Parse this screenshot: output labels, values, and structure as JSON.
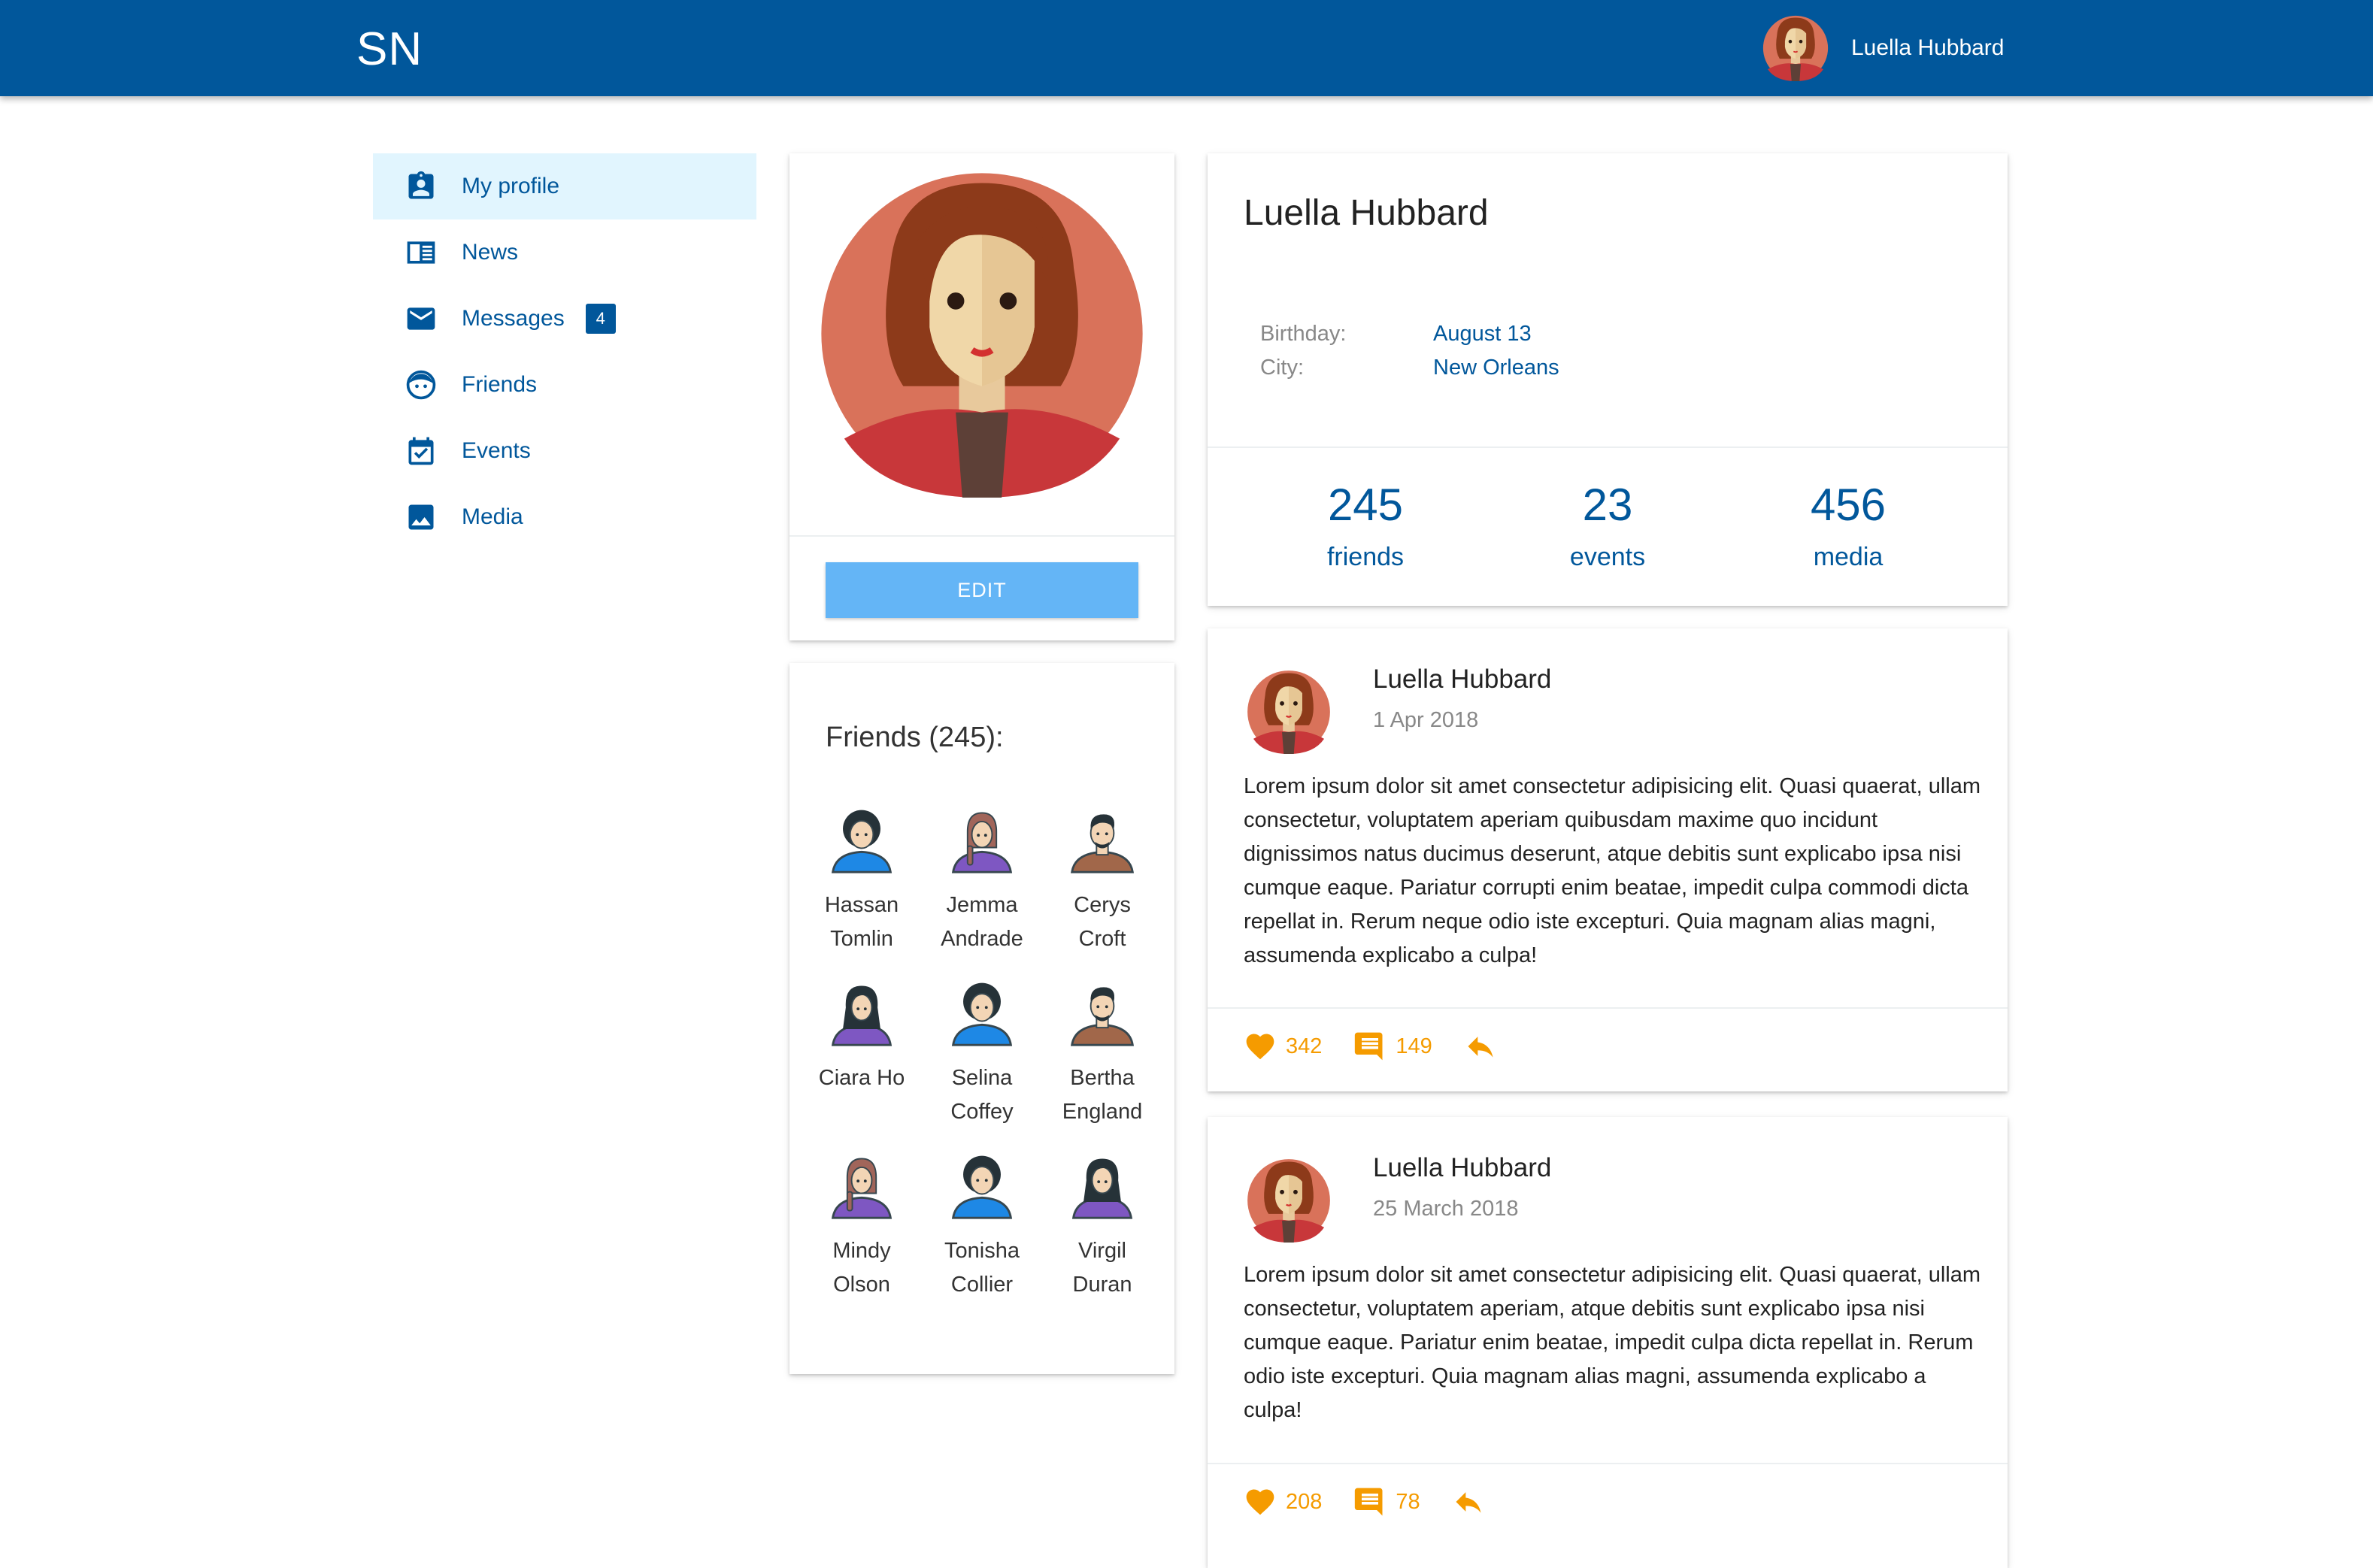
{
  "app": {
    "logo": "SN"
  },
  "header": {
    "user_name": "Luella Hubbard"
  },
  "sidebar": {
    "items": [
      {
        "label": "My profile",
        "icon": "profile-badge-icon",
        "active": true
      },
      {
        "label": "News",
        "icon": "newspaper-icon"
      },
      {
        "label": "Messages",
        "icon": "envelope-icon",
        "badge": "4"
      },
      {
        "label": "Friends",
        "icon": "face-icon"
      },
      {
        "label": "Events",
        "icon": "calendar-check-icon"
      },
      {
        "label": "Media",
        "icon": "image-icon"
      }
    ]
  },
  "profile": {
    "edit_label": "EDIT",
    "name": "Luella Hubbard",
    "birthday_label": "Birthday:",
    "birthday_value": "August 13",
    "city_label": "City:",
    "city_value": "New Orleans",
    "stats": [
      {
        "value": "245",
        "label": "friends"
      },
      {
        "value": "23",
        "label": "events"
      },
      {
        "value": "456",
        "label": "media"
      }
    ]
  },
  "friends": {
    "title": "Friends (245):",
    "list": [
      {
        "first": "Hassan",
        "last": "Tomlin",
        "avatar": "afro-blue"
      },
      {
        "first": "Jemma",
        "last": "Andrade",
        "avatar": "braid-purple"
      },
      {
        "first": "Cerys",
        "last": "Croft",
        "avatar": "man-brown"
      },
      {
        "first": "Ciara Ho",
        "last": "",
        "avatar": "longhair-purple"
      },
      {
        "first": "Selina",
        "last": "Coffey",
        "avatar": "afro-blue"
      },
      {
        "first": "Bertha",
        "last": "England",
        "avatar": "man-brown"
      },
      {
        "first": "Mindy",
        "last": "Olson",
        "avatar": "braid-purple"
      },
      {
        "first": "Tonisha",
        "last": "Collier",
        "avatar": "afro-blue"
      },
      {
        "first": "Virgil",
        "last": "Duran",
        "avatar": "longhair-purple"
      }
    ]
  },
  "posts": [
    {
      "author": "Luella Hubbard",
      "date": "1 Apr 2018",
      "text": "Lorem ipsum dolor sit amet consectetur adipisicing elit. Quasi quaerat, ullam consectetur, voluptatem aperiam quibusdam maxime quo incidunt dignissimos natus ducimus deserunt, atque debitis sunt explicabo ipsa nisi cumque eaque. Pariatur corrupti enim beatae, impedit culpa commodi dicta repellat in. Rerum neque odio iste excepturi. Quia magnam alias magni, assumenda explicabo a culpa!",
      "likes": "342",
      "comments": "149"
    },
    {
      "author": "Luella Hubbard",
      "date": "25 March 2018",
      "text": "Lorem ipsum dolor sit amet consectetur adipisicing elit. Quasi quaerat, ullam consectetur, voluptatem aperiam, atque debitis sunt explicabo ipsa nisi cumque eaque. Pariatur enim beatae, impedit culpa dicta repellat in. Rerum odio iste excepturi. Quia magnam alias magni, assumenda explicabo a culpa!",
      "likes": "208",
      "comments": "78"
    }
  ],
  "colors": {
    "primary": "#01579b",
    "active_bg": "#e1f5fe",
    "button": "#64b5f6",
    "action": "#f59b00"
  }
}
